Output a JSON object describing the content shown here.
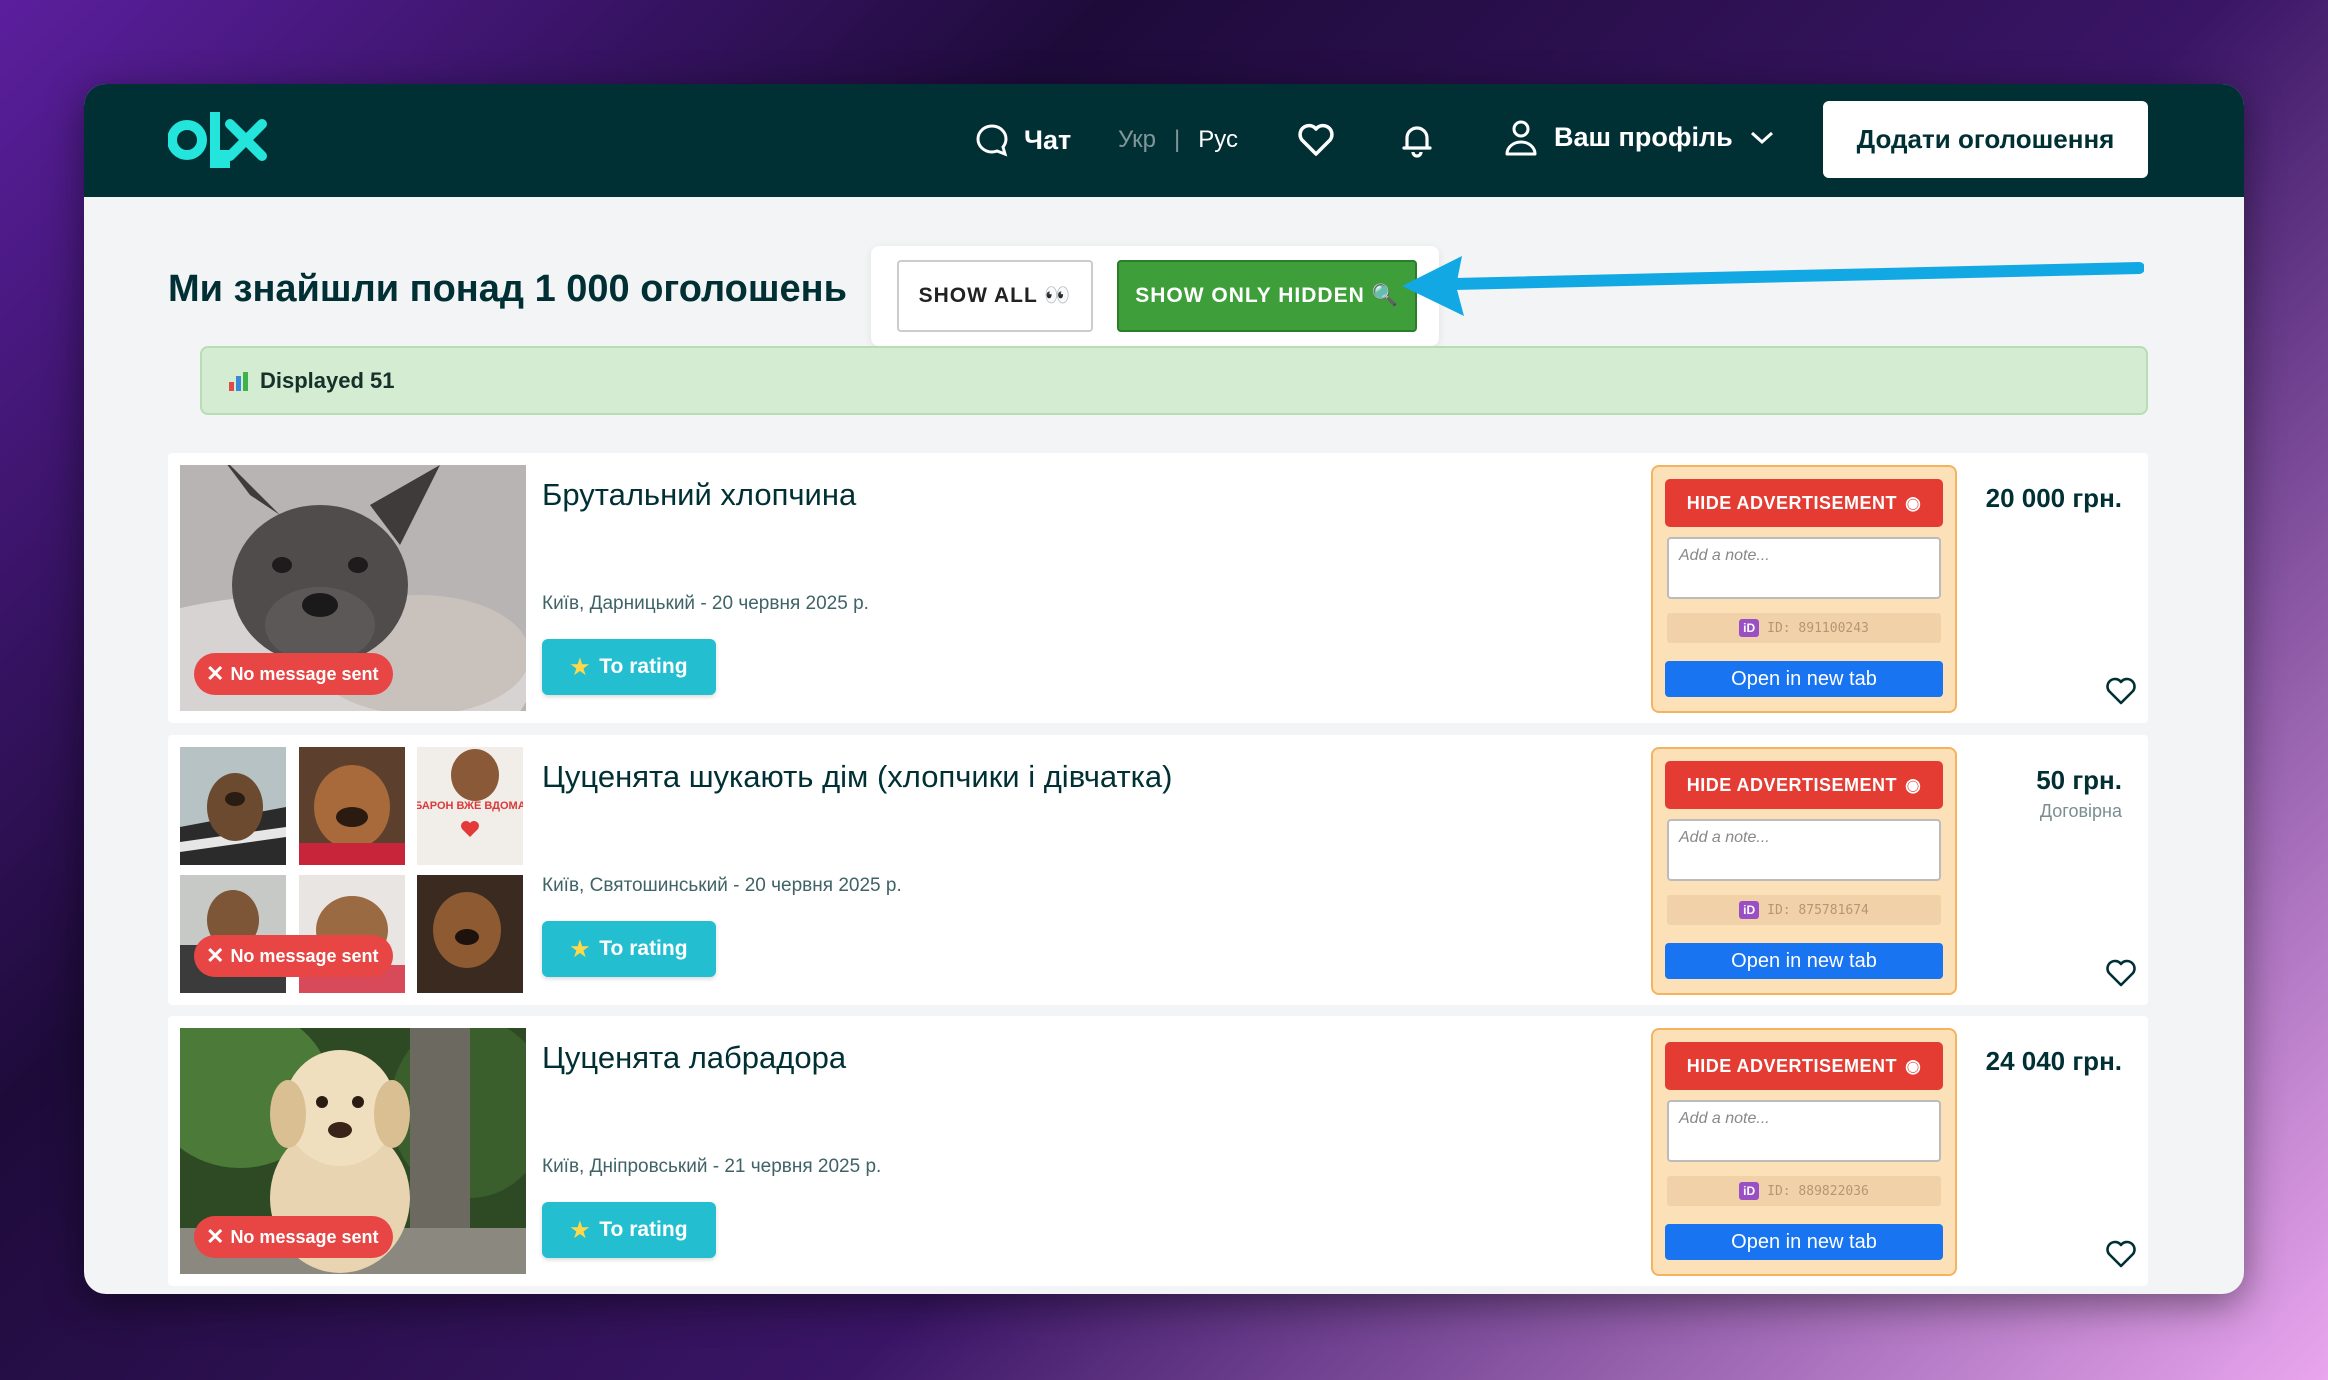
{
  "header": {
    "logo_text": "olx",
    "chat_label": "Чат",
    "lang_ukr": "Укр",
    "lang_sep": "|",
    "lang_rus": "Рус",
    "profile_label": "Ваш профіль",
    "add_button": "Додати оголошення"
  },
  "main": {
    "title": "Ми знайшли понад 1 000 оголошень",
    "show_all": "SHOW ALL 👀",
    "show_hidden": "SHOW ONLY HIDDEN 🔍",
    "displayed": "Displayed 51"
  },
  "panel_labels": {
    "hide": "HIDE ADVERTISEMENT",
    "note_placeholder": "Add a note...",
    "open_tab": "Open in new tab",
    "no_message": "No message sent",
    "rating": "To rating"
  },
  "listings": [
    {
      "title": "Брутальний хлопчина",
      "location": "Київ, Дарницький - 20 червня 2025 р.",
      "price": "20 000 грн.",
      "price_note": "",
      "id": "ID: 891100243"
    },
    {
      "title": "Цуценята шукають дім (хлопчики і дівчатка)",
      "location": "Київ, Святошинський - 20 червня 2025 р.",
      "price": "50 грн.",
      "price_note": "Договірна",
      "id": "ID: 875781674",
      "photo_caption": "БАРОН ВЖЕ ВДОМА"
    },
    {
      "title": "Цуценята лабрадора",
      "location": "Київ, Дніпровський - 21 червня 2025 р.",
      "price": "24 040 грн.",
      "price_note": "",
      "id": "ID: 889822036"
    }
  ],
  "colors": {
    "header_bg": "#002f34",
    "accent_teal": "#23bfd1",
    "hide_red": "#e43b33",
    "open_blue": "#1874f0",
    "panel_bg": "#fce0b8",
    "show_hidden_green": "#3e9f3a"
  }
}
